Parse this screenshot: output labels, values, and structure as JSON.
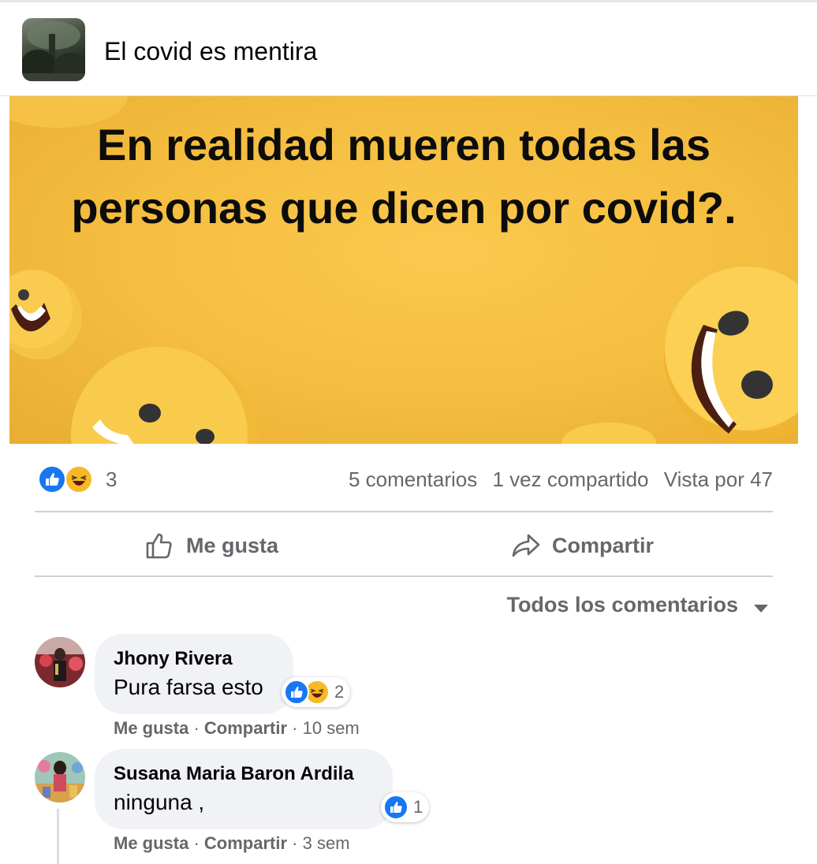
{
  "header": {
    "page_name": "El covid es mentira"
  },
  "post": {
    "text_line1": "En realidad mueren todas las",
    "text_line2": "personas que dicen por covid?.",
    "reaction_count": "3",
    "comments_count": "5 comentarios",
    "shares_count": "1 vez compartido",
    "views": "Vista por 47"
  },
  "actions": {
    "like_label": "Me gusta",
    "share_label": "Compartir"
  },
  "comments_sort": {
    "label": "Todos los comentarios"
  },
  "comments": [
    {
      "author": "Jhony Rivera",
      "text": "Pura farsa esto",
      "reactions": [
        "like-icon",
        "haha-icon"
      ],
      "reaction_count": "2",
      "like_label": "Me gusta",
      "sep1": " · ",
      "share_label": "Compartir",
      "sep2": " · ",
      "time": "10 sem"
    },
    {
      "author": "Susana Maria Baron Ardila",
      "text": "ninguna ,",
      "reactions": [
        "like-icon"
      ],
      "reaction_count": "1",
      "like_label": "Me gusta",
      "sep1": " · ",
      "share_label": "Compartir",
      "sep2": " · ",
      "time": "3 sem"
    }
  ],
  "colors": {
    "brand_blue": "#1877f2",
    "haha_yellow": "#f7b928",
    "secondary_text": "#65676b",
    "bubble_bg": "#f0f2f5",
    "image_bg": "#f4bd3f"
  }
}
